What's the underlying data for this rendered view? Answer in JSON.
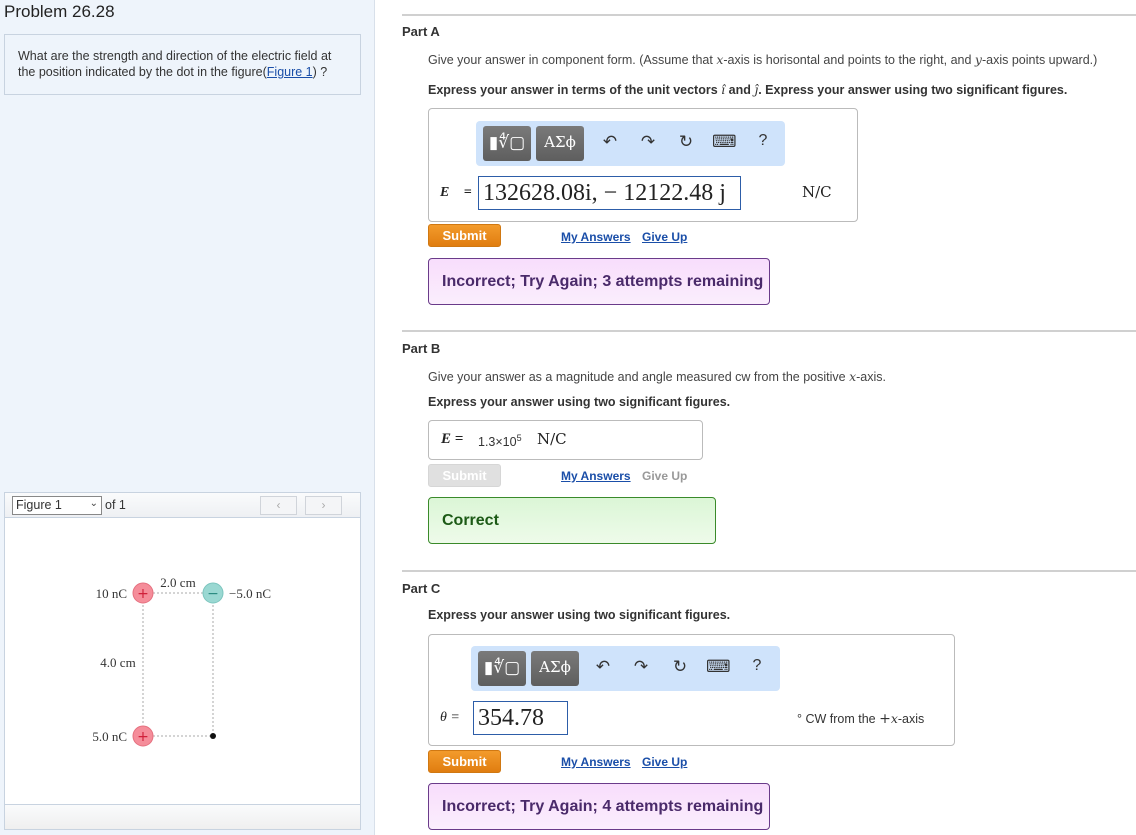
{
  "problem": {
    "title": "Problem 26.28",
    "question_text": "What are the strength and direction of the electric field at the position indicated by the dot in the figure(",
    "figure_link": "Figure 1",
    "question_suffix": ") ?"
  },
  "figure_panel": {
    "selected": "Figure 1",
    "of_label": "of 1",
    "prev_icon": "‹",
    "next_icon": "›",
    "diagram": {
      "charges": [
        {
          "label": "10 nC",
          "sign": "+",
          "color": "#f07a8a"
        },
        {
          "label": "−5.0 nC",
          "sign": "−",
          "color": "#8fd3cc"
        },
        {
          "label": "5.0 nC",
          "sign": "+",
          "color": "#f07a8a"
        }
      ],
      "dimensions": {
        "horizontal": "2.0 cm",
        "vertical": "4.0 cm"
      }
    }
  },
  "parts": {
    "a": {
      "title": "Part A",
      "instruction1_pre": "Give your answer in component form. (Assume that ",
      "x_var": "x",
      "instruction1_mid": "-axis is horisontal and points to the right, and ",
      "y_var": "y",
      "instruction1_post": "-axis points upward.)",
      "instruction2_pre": "Express your answer in terms of the unit vectors ",
      "i_hat": "î",
      "and": " and ",
      "j_hat": "ĵ",
      "instruction2_post": ". Express your answer using two significant figures.",
      "var_label": "E⃗ =",
      "answer_value": "132628.08i, − 12122.48 j",
      "unit": "N/C",
      "submit": "Submit",
      "my_answers": "My Answers",
      "give_up": "Give Up",
      "feedback": "Incorrect; Try Again; 3 attempts remaining"
    },
    "b": {
      "title": "Part B",
      "instruction1_pre": "Give your answer as a magnitude and angle measured cw from the positive ",
      "x_var": "x",
      "instruction1_post": "-axis.",
      "instruction2": "Express your answer using two significant figures.",
      "var_label": "E =",
      "answer_mantissa": "1.3×10",
      "answer_exp": "5",
      "unit": "N/C",
      "submit": "Submit",
      "my_answers": "My Answers",
      "give_up": "Give Up",
      "feedback": "Correct"
    },
    "c": {
      "title": "Part C",
      "instruction": "Express your answer using two significant figures.",
      "var_label": "θ =",
      "answer_value": "354.78",
      "unit_pre": "° CW from the ",
      "unit_plus": "+",
      "unit_x": "x",
      "unit_post": "-axis",
      "submit": "Submit",
      "my_answers": "My Answers",
      "give_up": "Give Up",
      "feedback": "Incorrect; Try Again; 4 attempts remaining"
    }
  },
  "toolbar": {
    "templates_label": "▮∜▢",
    "symbols_label": "ΑΣϕ",
    "undo_icon": "↶",
    "redo_icon": "↷",
    "reset_icon": "↻",
    "keyboard_icon": "⌨",
    "help_icon": "?"
  },
  "colors": {
    "submit_orange": "#e8871c",
    "link_blue": "#1a4ea8",
    "incorrect_border": "#6a3b8a",
    "correct_border": "#3a8a2a",
    "toolbar_bg": "#cfe3fb"
  }
}
